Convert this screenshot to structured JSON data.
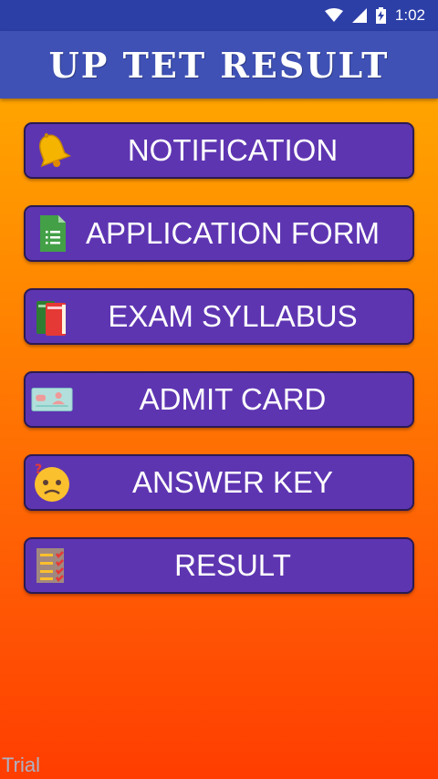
{
  "status_bar": {
    "time": "1:02",
    "icons": [
      "wifi-icon",
      "signal-icon",
      "battery-charging-icon"
    ]
  },
  "app_bar": {
    "title": "UP TET RESULT"
  },
  "menu": [
    {
      "label": "NOTIFICATION",
      "icon": "bell-icon"
    },
    {
      "label": "APPLICATION FORM",
      "icon": "form-document-icon"
    },
    {
      "label": "EXAM SYLLABUS",
      "icon": "books-icon"
    },
    {
      "label": "ADMIT CARD",
      "icon": "id-card-icon"
    },
    {
      "label": "ANSWER KEY",
      "icon": "confused-face-icon"
    },
    {
      "label": "RESULT",
      "icon": "checklist-icon"
    }
  ],
  "watermark": "Trial",
  "colors": {
    "status_bar": "#2c3fa7",
    "app_bar": "#3f51b5",
    "button": "#5e35b1",
    "gradient_top": "#ffb300",
    "gradient_bottom": "#ff3d00"
  }
}
